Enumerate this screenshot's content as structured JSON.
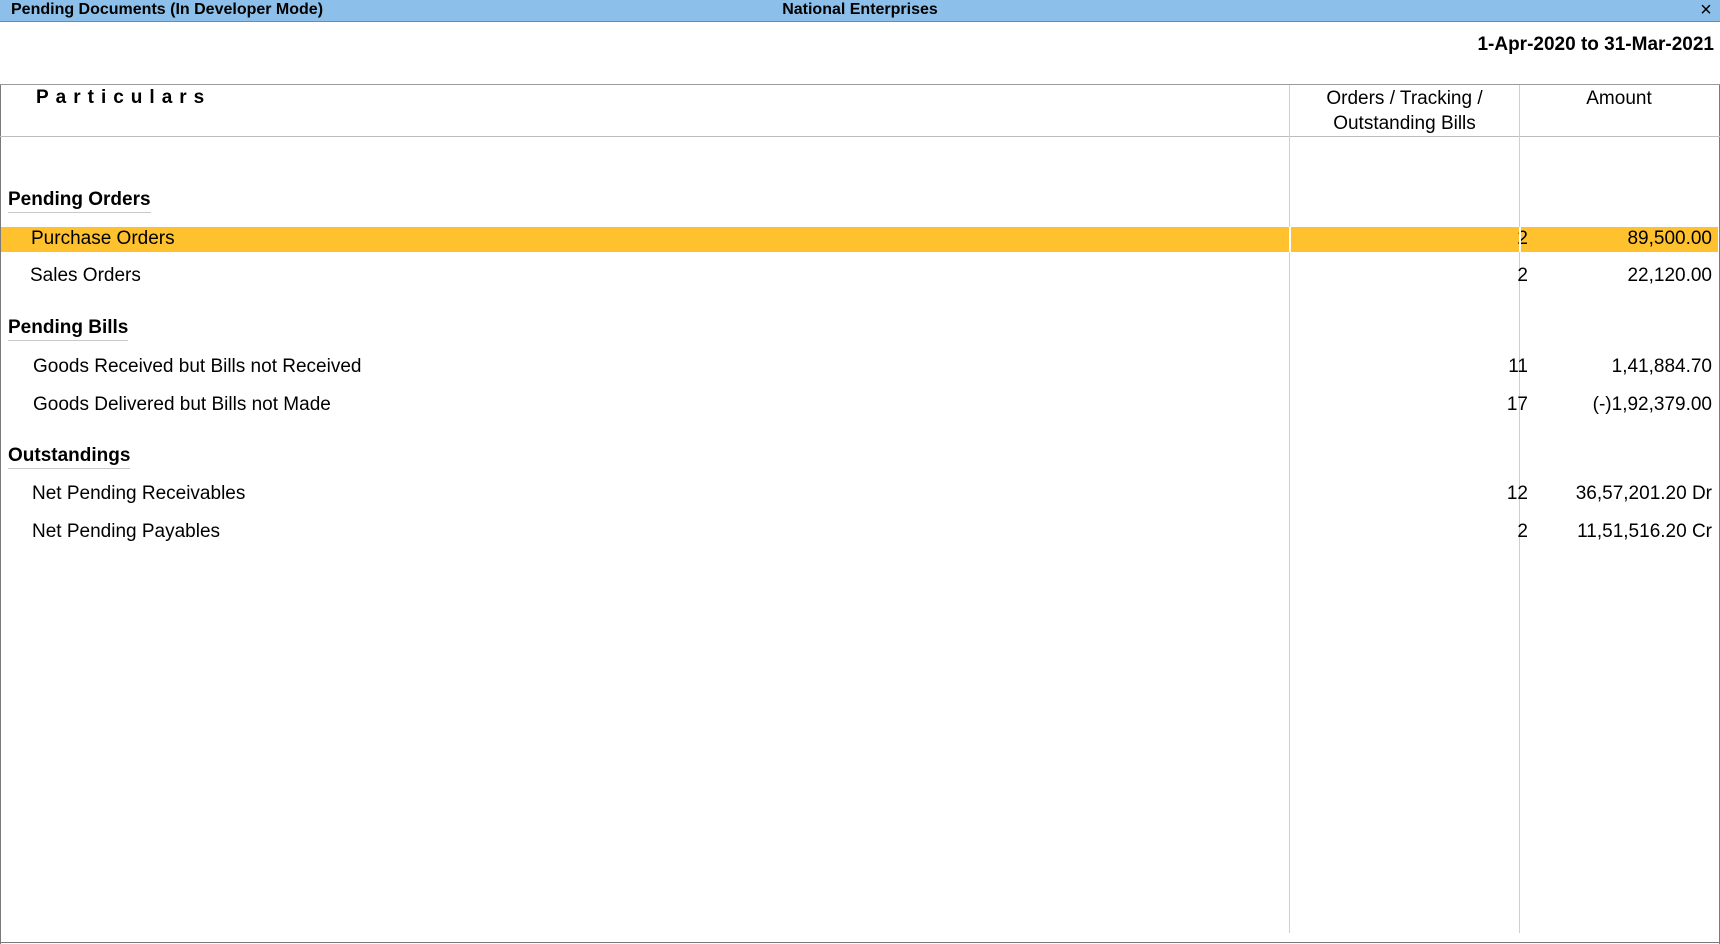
{
  "window": {
    "title": "Pending Documents (In Developer Mode)",
    "company": "National Enterprises",
    "close_icon": "×"
  },
  "period": "1-Apr-2020 to 31-Mar-2021",
  "columns": {
    "particulars": "Particulars",
    "orders_line1": "Orders / Tracking /",
    "orders_line2": "Outstanding Bills",
    "amount": "Amount"
  },
  "groups": [
    {
      "title": "Pending Orders",
      "rows": [
        {
          "label": "Purchase Orders",
          "count": "2",
          "amount": "89,500.00",
          "selected": true
        },
        {
          "label": "Sales Orders",
          "count": "2",
          "amount": "22,120.00"
        }
      ]
    },
    {
      "title": "Pending Bills",
      "rows": [
        {
          "label": "Goods Received but Bills not Received",
          "count": "11",
          "amount": "1,41,884.70"
        },
        {
          "label": "Goods Delivered but Bills not Made",
          "count": "17",
          "amount": "(-)1,92,379.00"
        }
      ]
    },
    {
      "title": "Outstandings",
      "rows": [
        {
          "label": "Net Pending Receivables",
          "count": "12",
          "amount": "36,57,201.20 Dr"
        },
        {
          "label": "Net Pending Payables",
          "count": "2",
          "amount": "11,51,516.20 Cr"
        }
      ]
    }
  ],
  "colors": {
    "titlebar": "#8cc0ea",
    "selection": "#ffc22e"
  }
}
